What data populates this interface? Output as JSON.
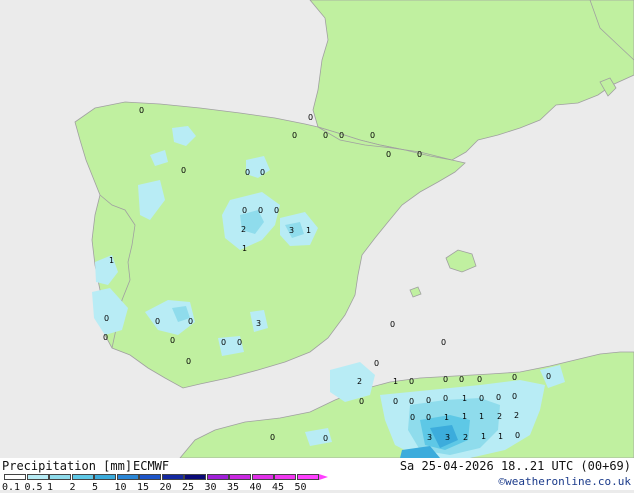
{
  "footer": {
    "title": "Precipitation [mm]",
    "model": "ECMWF",
    "datetime": "Sa 25-04-2026 18..21 UTC (00+69)",
    "credit": "©weatheronline.co.uk"
  },
  "legend": {
    "ticks": [
      "0.1",
      "0.5",
      "1",
      "2",
      "5",
      "10",
      "15",
      "20",
      "25",
      "30",
      "35",
      "40",
      "45",
      "50"
    ],
    "colors": [
      "#ffffff",
      "#b8ecf5",
      "#8fdcec",
      "#5ec8e6",
      "#3cacdc",
      "#2a86d6",
      "#1d55c8",
      "#1428a0",
      "#0a0a78",
      "#a020d8",
      "#c828e0",
      "#e030e8",
      "#f038f0",
      "#ff40ff"
    ]
  },
  "colors": {
    "sea": "#ebebeb",
    "land": "#c0f0a0",
    "border": "#a0a0a0",
    "precip_light": "#b8ecf5",
    "precip_mid": "#8fdcec",
    "precip_heavy": "#3cacdc"
  },
  "map_labels": [
    "0",
    "0",
    "0",
    "0",
    "0",
    "0",
    "0",
    "0",
    "0",
    "0",
    "0",
    "0",
    "0",
    "0",
    "2",
    "3",
    "1",
    "1",
    "1",
    "0",
    "0",
    "0",
    "0",
    "0",
    "0",
    "0",
    "0",
    "3",
    "0",
    "0",
    "0",
    "0",
    "2",
    "1",
    "0",
    "0",
    "0",
    "0",
    "0",
    "0",
    "0",
    "0",
    "0",
    "0",
    "1",
    "0",
    "0",
    "0",
    "0",
    "0",
    "1",
    "1",
    "1",
    "2",
    "2",
    "0",
    "3",
    "3",
    "2",
    "1",
    "1",
    "0",
    "0"
  ]
}
